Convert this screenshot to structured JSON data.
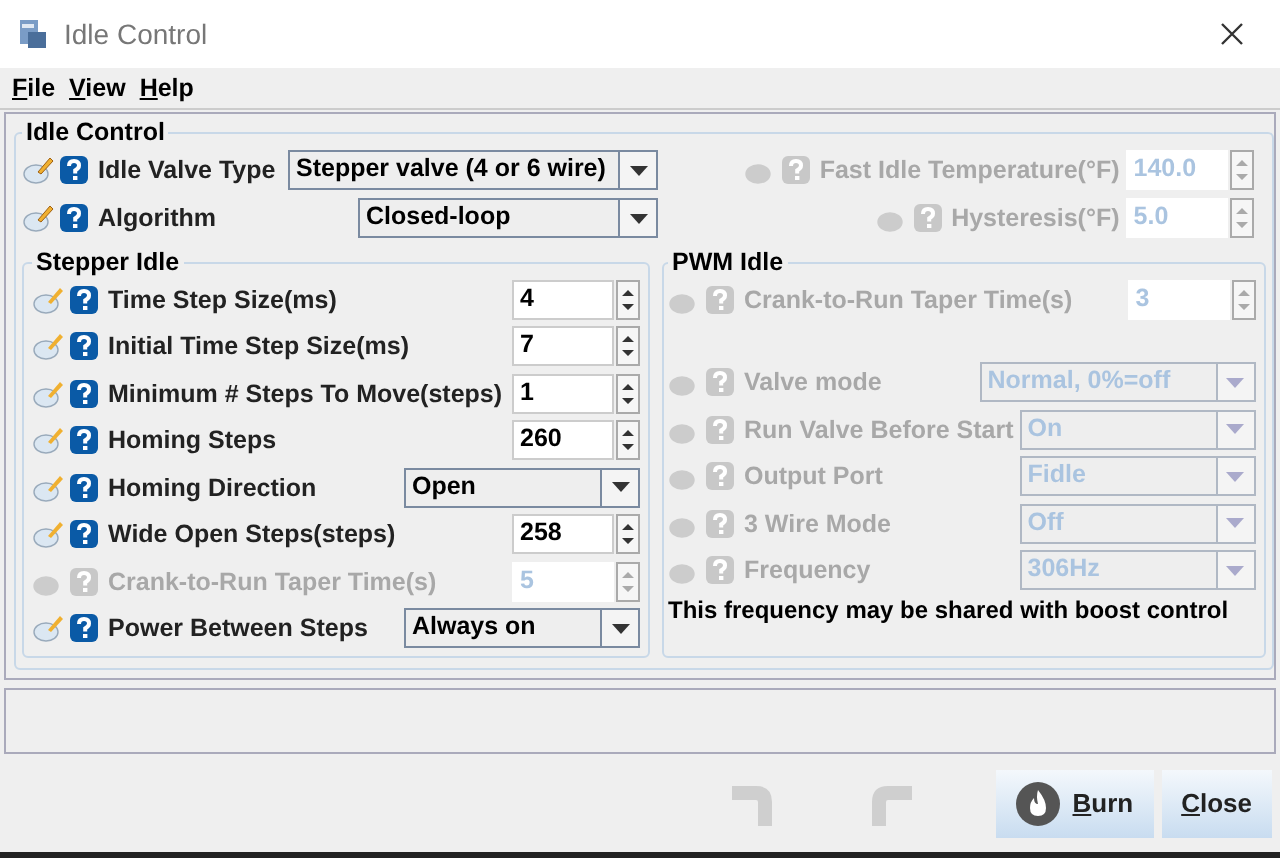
{
  "window": {
    "title": "Idle Control"
  },
  "menu": [
    {
      "label": "File"
    },
    {
      "label": "View"
    },
    {
      "label": "Help"
    }
  ],
  "idle_control": {
    "title": "Idle Control",
    "left": [
      {
        "kind": "select",
        "label": "Idle Valve Type",
        "value": "Stepper valve (4 or 6 wire)",
        "disabled": false
      },
      {
        "kind": "select",
        "label": "Algorithm",
        "value": "Closed-loop",
        "disabled": false
      }
    ],
    "right": [
      {
        "kind": "spinner",
        "label": "Fast Idle Temperature(°F)",
        "value": "140.0",
        "disabled": true
      },
      {
        "kind": "spinner",
        "label": "Hysteresis(°F)",
        "value": "5.0",
        "disabled": true
      }
    ]
  },
  "stepper_idle": {
    "title": "Stepper Idle",
    "fields": [
      {
        "kind": "spinner",
        "label": "Time Step Size(ms)",
        "value": "4",
        "disabled": false
      },
      {
        "kind": "spinner",
        "label": "Initial Time Step Size(ms)",
        "value": "7",
        "disabled": false
      },
      {
        "kind": "spinner",
        "label": "Minimum # Steps To Move(steps)",
        "value": "1",
        "disabled": false
      },
      {
        "kind": "spinner",
        "label": "Homing Steps",
        "value": "260",
        "disabled": false
      },
      {
        "kind": "select",
        "label": "Homing Direction",
        "value": "Open",
        "disabled": false
      },
      {
        "kind": "spinner",
        "label": "Wide Open Steps(steps)",
        "value": "258",
        "disabled": false
      },
      {
        "kind": "spinner",
        "label": "Crank-to-Run Taper Time(s)",
        "value": "5",
        "disabled": true
      },
      {
        "kind": "select",
        "label": "Power Between Steps",
        "value": "Always on",
        "disabled": false
      }
    ]
  },
  "pwm_idle": {
    "title": "PWM Idle",
    "fields": [
      {
        "kind": "spinner",
        "label": "Crank-to-Run Taper Time(s)",
        "value": "3",
        "disabled": true
      },
      {
        "kind": "select",
        "label": "Valve mode",
        "value": "Normal, 0%=off",
        "disabled": true
      },
      {
        "kind": "select",
        "label": "Run Valve Before Start",
        "value": "On",
        "disabled": true
      },
      {
        "kind": "select",
        "label": "Output Port",
        "value": "Fidle",
        "disabled": true
      },
      {
        "kind": "select",
        "label": "3 Wire Mode",
        "value": "Off",
        "disabled": true
      },
      {
        "kind": "select",
        "label": "Frequency",
        "value": "306Hz",
        "disabled": true
      }
    ],
    "note": "This frequency may be shared with boost control"
  },
  "toolbar": {
    "undo_disabled": true,
    "redo_disabled": true
  },
  "buttons": [
    {
      "kind": "burn",
      "label": "Burn"
    },
    {
      "kind": "close",
      "label": "Close"
    }
  ]
}
